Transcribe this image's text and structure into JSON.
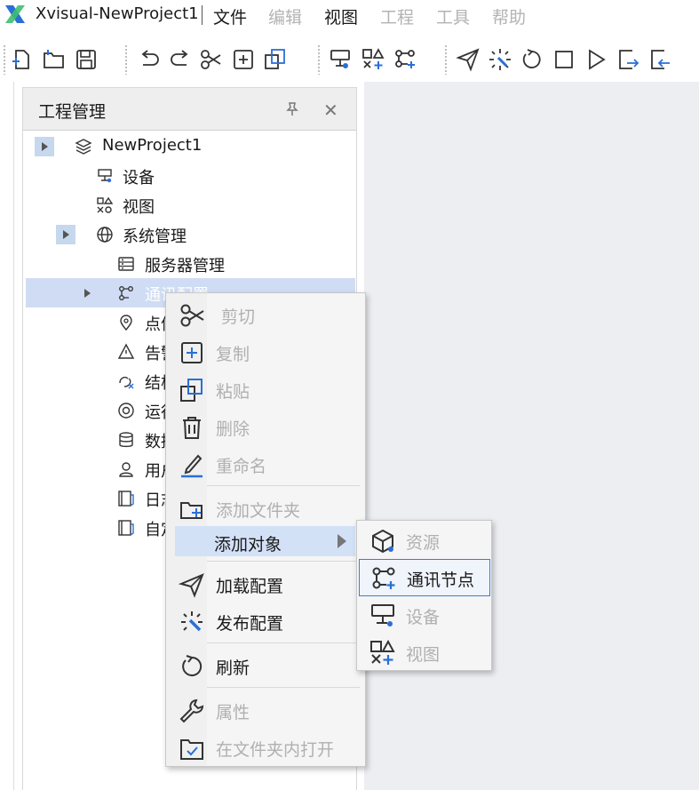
{
  "app": {
    "title": "Xvisual-NewProject1",
    "logo": "xvisual-logo-icon",
    "brand_color": "#2a6fd6"
  },
  "menu": [
    {
      "label": "文件",
      "enabled": true
    },
    {
      "label": "编辑",
      "enabled": false
    },
    {
      "label": "视图",
      "enabled": true
    },
    {
      "label": "工程",
      "enabled": false
    },
    {
      "label": "工具",
      "enabled": false
    },
    {
      "label": "帮助",
      "enabled": false
    }
  ],
  "toolbar": {
    "groups": [
      [
        "new-file-icon",
        "open-folder-icon",
        "save-icon"
      ],
      [
        "undo-icon",
        "redo-icon",
        "cut-icon",
        "copy-icon",
        "paste-icon"
      ],
      [
        "device-icon",
        "view-icon",
        "comm-node-icon"
      ],
      [
        "load-config-icon",
        "publish-icon",
        "refresh-icon",
        "stop-icon",
        "run-icon",
        "export-icon",
        "import-icon"
      ]
    ]
  },
  "panel": {
    "title": "工程管理",
    "pin_icon": "pin-icon",
    "close_glyph": "✕"
  },
  "tree": [
    {
      "label": "NewProject1",
      "icon": "layers-icon",
      "expander": true
    },
    {
      "label": "设备",
      "icon": "device-icon"
    },
    {
      "label": "视图",
      "icon": "view-icon"
    },
    {
      "label": "系统管理",
      "icon": "globe-icon",
      "expander": true
    },
    {
      "label": "服务器管理",
      "icon": "server-icon"
    },
    {
      "label": "通讯配置",
      "icon": "comm-node-icon",
      "expander": true,
      "selected": true
    },
    {
      "label": "点信",
      "icon": "location-icon"
    },
    {
      "label": "告警",
      "icon": "alarm-icon"
    },
    {
      "label": "结构",
      "icon": "structure-icon"
    },
    {
      "label": "运行",
      "icon": "target-icon"
    },
    {
      "label": "数据",
      "icon": "database-icon"
    },
    {
      "label": "用户",
      "icon": "user-icon"
    },
    {
      "label": "日志",
      "icon": "log-icon"
    },
    {
      "label": "自定",
      "icon": "log-icon"
    }
  ],
  "context_menu": {
    "items": [
      {
        "label": "剪切",
        "icon": "cut-icon",
        "enabled": false
      },
      {
        "label": "复制",
        "icon": "copy-icon",
        "enabled": false
      },
      {
        "label": "粘贴",
        "icon": "paste-icon",
        "enabled": false
      },
      {
        "label": "删除",
        "icon": "delete-icon",
        "enabled": false
      },
      {
        "label": "重命名",
        "icon": "rename-icon",
        "enabled": false
      },
      {
        "label": "添加文件夹",
        "icon": "add-folder-icon",
        "enabled": false
      },
      {
        "label": "添加对象",
        "icon": "",
        "enabled": true,
        "highlighted": true,
        "submenu": true
      },
      {
        "label": "加载配置",
        "icon": "load-config-icon",
        "enabled": true
      },
      {
        "label": "发布配置",
        "icon": "publish-icon",
        "enabled": true
      },
      {
        "label": "刷新",
        "icon": "refresh-icon",
        "enabled": true
      },
      {
        "label": "属性",
        "icon": "wrench-icon",
        "enabled": false
      },
      {
        "label": "在文件夹内打开",
        "icon": "open-in-folder-icon",
        "enabled": false
      }
    ]
  },
  "submenu": {
    "items": [
      {
        "label": "资源",
        "icon": "cube-icon",
        "enabled": false
      },
      {
        "label": "通讯节点",
        "icon": "comm-node-icon",
        "enabled": true,
        "focused": true
      },
      {
        "label": "设备",
        "icon": "device-icon",
        "enabled": false
      },
      {
        "label": "视图",
        "icon": "view-icon",
        "enabled": false
      }
    ]
  },
  "colors": {
    "selection": "#cfdcf4",
    "menu_highlight": "#d3e1f7",
    "focus_border": "#3d7ed1",
    "icon_accent": "#2a6fd6",
    "workspace": "#eceef2"
  }
}
